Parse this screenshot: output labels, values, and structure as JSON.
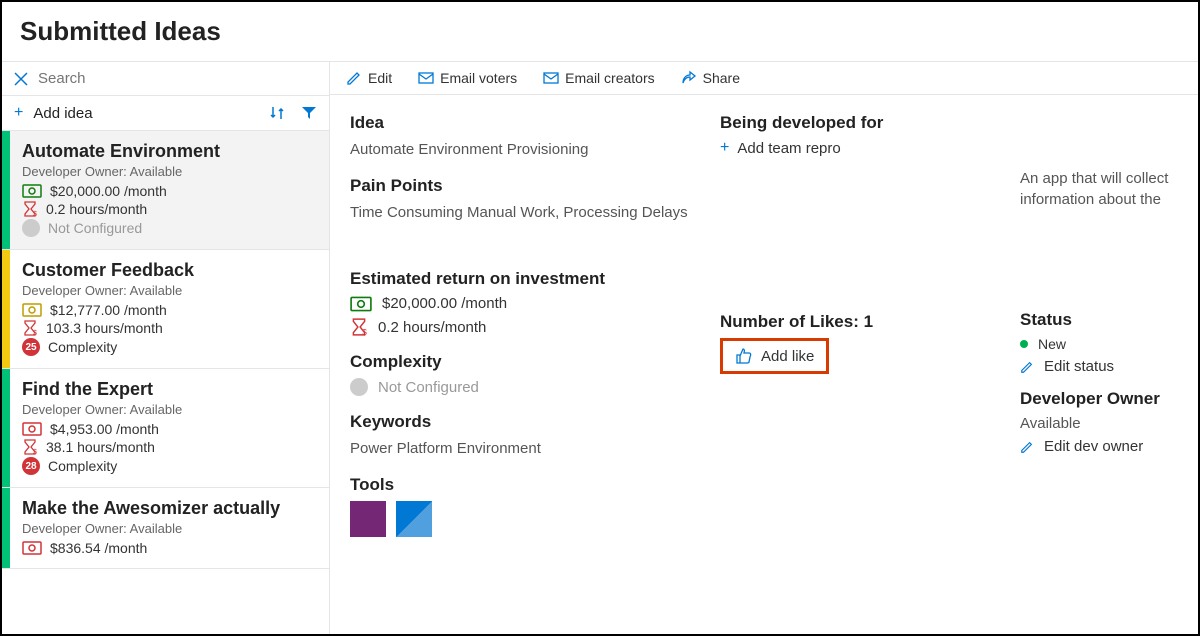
{
  "header": {
    "title": "Submitted Ideas"
  },
  "search": {
    "placeholder": "Search"
  },
  "addIdea": {
    "label": "Add idea"
  },
  "ideas": [
    {
      "title": "Automate Environment",
      "owner": "Developer Owner: Available",
      "cost": "$20,000.00 /month",
      "hours": "0.2 hours/month",
      "complexityLabel": "Not Configured",
      "badge": "",
      "bar": "green",
      "selected": true,
      "iconColor": "green"
    },
    {
      "title": "Customer Feedback",
      "owner": "Developer Owner: Available",
      "cost": "$12,777.00 /month",
      "hours": "103.3 hours/month",
      "complexityLabel": "Complexity",
      "badge": "25",
      "bar": "yellow",
      "selected": false,
      "iconColor": "yellow"
    },
    {
      "title": "Find the Expert",
      "owner": "Developer Owner: Available",
      "cost": "$4,953.00 /month",
      "hours": "38.1 hours/month",
      "complexityLabel": "Complexity",
      "badge": "28",
      "bar": "green",
      "selected": false,
      "iconColor": "red"
    },
    {
      "title": "Make the Awesomizer actually",
      "owner": "Developer Owner: Available",
      "cost": "$836.54 /month",
      "hours": "",
      "complexityLabel": "",
      "badge": "",
      "bar": "green",
      "selected": false,
      "iconColor": "red"
    }
  ],
  "toolbar": {
    "edit": "Edit",
    "emailVoters": "Email voters",
    "emailCreators": "Email creators",
    "share": "Share"
  },
  "detail": {
    "ideaLabel": "Idea",
    "ideaValue": "Automate Environment Provisioning",
    "painLabel": "Pain Points",
    "painValue": "Time Consuming Manual Work, Processing Delays",
    "roiLabel": "Estimated return on investment",
    "roiCost": "$20,000.00 /month",
    "roiHours": "0.2 hours/month",
    "complexityLabel": "Complexity",
    "complexityValue": "Not Configured",
    "keywordsLabel": "Keywords",
    "keywordsValue": "Power Platform Environment",
    "toolsLabel": "Tools",
    "beingDevLabel": "Being developed for",
    "addTeam": "Add team repro",
    "likesLabel": "Number of Likes: 1",
    "addLike": "Add like",
    "description": "An app that will collect information about the",
    "statusLabel": "Status",
    "statusValue": "New",
    "editStatus": "Edit status",
    "devOwnerLabel": "Developer Owner",
    "devOwnerValue": "Available",
    "editDevOwner": "Edit dev owner"
  }
}
